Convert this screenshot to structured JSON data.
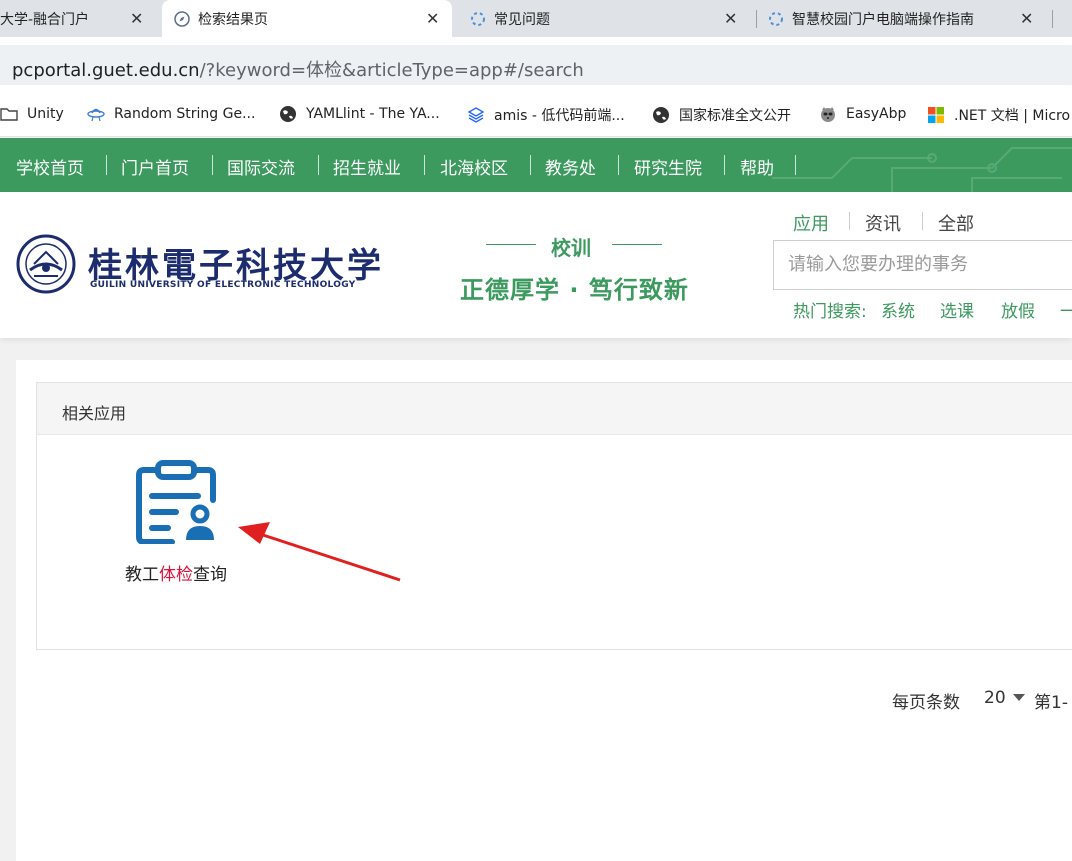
{
  "browser": {
    "tabs": [
      {
        "label": "大学-融合门户",
        "icon": "portal-icon",
        "active": false
      },
      {
        "label": "检索结果页",
        "icon": "compass-icon",
        "active": true
      },
      {
        "label": "常见问题",
        "icon": "loading-icon",
        "active": false
      },
      {
        "label": "智慧校园门户电脑端操作指南",
        "icon": "loading-icon",
        "active": false
      }
    ],
    "close_glyph": "✕",
    "url": {
      "host": "pcportal.guet.edu.cn",
      "path": "/?keyword=体检&articleType=app#/search"
    },
    "bookmarks": [
      {
        "label": "Unity",
        "icon": "folder-icon"
      },
      {
        "label": "Random String Ge...",
        "icon": "ufo-icon"
      },
      {
        "label": "YAMLlint - The YA...",
        "icon": "globe-icon"
      },
      {
        "label": "amis - 低代码前端...",
        "icon": "layers-icon"
      },
      {
        "label": "国家标准全文公开",
        "icon": "globe-icon"
      },
      {
        "label": "EasyAbp",
        "icon": "raccoon-icon"
      },
      {
        "label": ".NET 文档 | Micro",
        "icon": "windows-icon"
      }
    ]
  },
  "nav": {
    "items": [
      "学校首页",
      "门户首页",
      "国际交流",
      "招生就业",
      "北海校区",
      "教务处",
      "研究生院",
      "帮助"
    ]
  },
  "header": {
    "logo_cn": "桂林電子科技大学",
    "logo_en": "GUILIN UNIVERSITY OF ELECTRONIC TECHNOLOGY",
    "motto_title": "校训",
    "motto_text": "正德厚学 · 笃行致新",
    "search_tabs": [
      "应用",
      "资讯",
      "全部"
    ],
    "search_placeholder": "请输入您要办理的事务",
    "hot_label": "热门搜索:",
    "hot_items": [
      "系统",
      "选课",
      "放假"
    ],
    "green": "#3c9a5f",
    "navy": "#1c2c6e"
  },
  "results": {
    "section_title": "相关应用",
    "app": {
      "label_prefix": "教工",
      "label_highlight": "体检",
      "label_suffix": "查询",
      "icon": "clipboard-user-icon",
      "icon_color": "#1a6fb4",
      "highlight_color": "#d8143a"
    }
  },
  "pagination": {
    "page_size_label": "每页条数",
    "page_size": "20",
    "page_info": "第1-"
  }
}
